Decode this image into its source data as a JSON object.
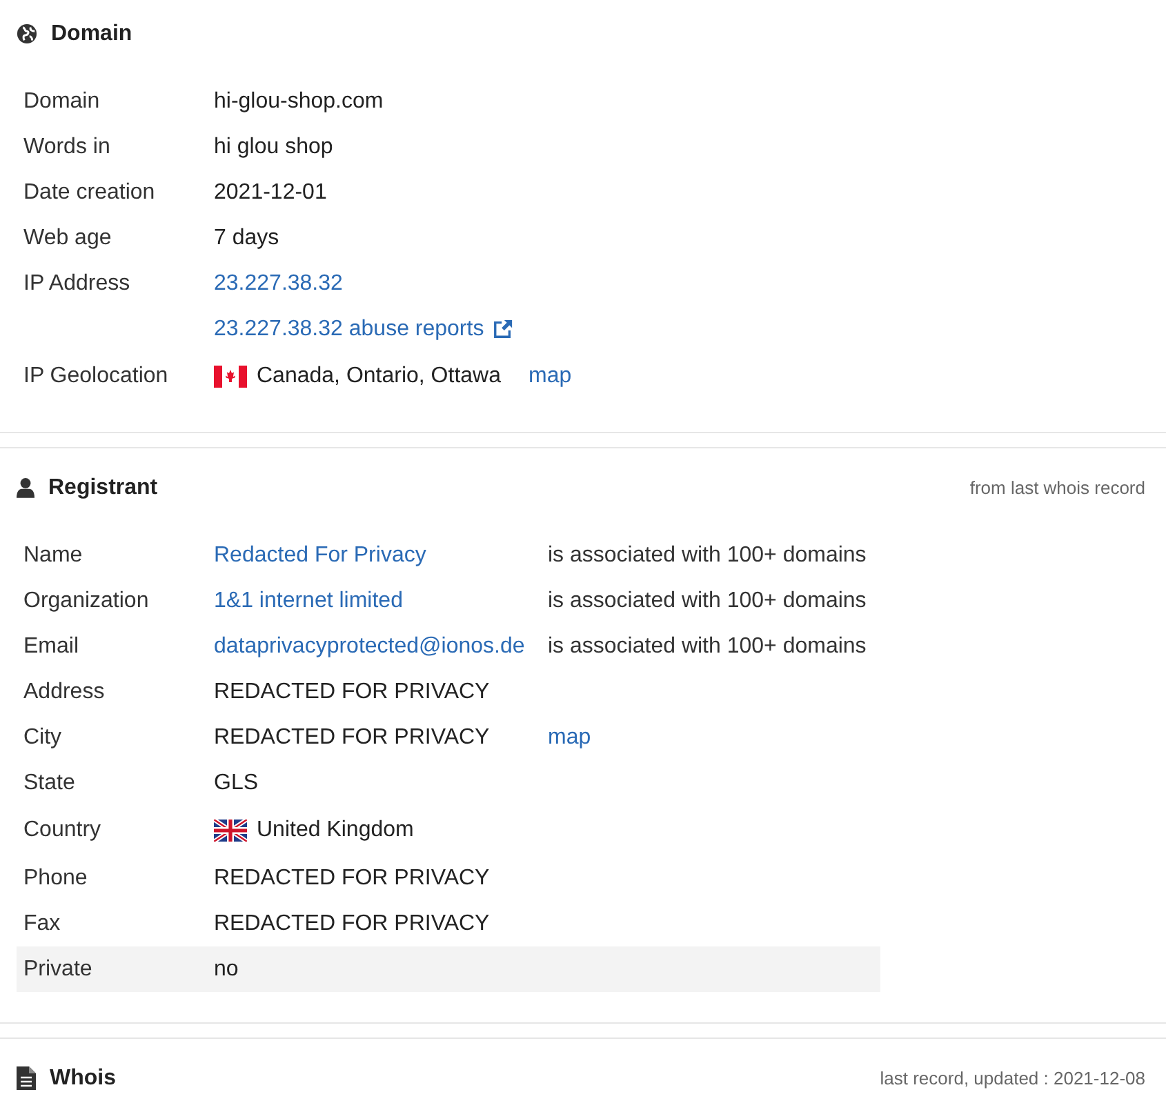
{
  "sections": [
    {
      "kind": "domain",
      "title": "Domain",
      "rows": [
        {
          "label": "Domain",
          "value": "hi-glou-shop.com",
          "kind": "text",
          "highlighted": false
        },
        {
          "label": "Words in",
          "value": "hi glou shop",
          "kind": "text",
          "highlighted": false
        },
        {
          "label": "Date creation",
          "value": "2021-12-01",
          "kind": "text",
          "highlighted": false
        },
        {
          "label": "Web age",
          "value": "7 days",
          "kind": "text",
          "highlighted": false
        },
        {
          "label": "IP Address",
          "value": "23.227.38.32",
          "kind": "link",
          "highlighted": false
        },
        {
          "value": "23.227.38.32 abuse reports",
          "kind": "external",
          "highlighted": false
        },
        {
          "label": "IP Geolocation",
          "value": "Canada, Ontario, Ottawa",
          "kind": "flagged",
          "map": "map",
          "highlighted": false
        }
      ]
    },
    {
      "kind": "registrant",
      "title": "Registrant",
      "note": "from last whois record",
      "rows": [
        {
          "label": "Name",
          "value": "Redacted For Privacy",
          "kind": "link",
          "assoc": "is associated with 100+ domains",
          "highlighted": false
        },
        {
          "label": "Organization",
          "value": "1&1 internet limited",
          "kind": "link",
          "assoc": "is associated with 100+ domains",
          "highlighted": false
        },
        {
          "label": "Email",
          "value": "dataprivacyprotected@ionos.de",
          "kind": "link",
          "assoc": "is associated with 100+ domains",
          "highlighted": false
        },
        {
          "label": "Address",
          "value": "REDACTED FOR PRIVACY",
          "kind": "text",
          "highlighted": false
        },
        {
          "label": "City",
          "value": "REDACTED FOR PRIVACY",
          "kind": "text",
          "map": "map",
          "highlighted": false
        },
        {
          "label": "State",
          "value": "GLS",
          "kind": "text",
          "highlighted": false
        },
        {
          "label": "Country",
          "value": "United Kingdom",
          "kind": "flagged",
          "highlighted": false
        },
        {
          "label": "Phone",
          "value": "REDACTED FOR PRIVACY",
          "kind": "text",
          "highlighted": false
        },
        {
          "label": "Fax",
          "value": "REDACTED FOR PRIVACY",
          "kind": "text",
          "highlighted": false
        },
        {
          "label": "Private",
          "value": "no",
          "kind": "text",
          "highlighted": true
        }
      ]
    },
    {
      "kind": "whois",
      "title": "Whois",
      "note": "last record, updated : 2021-12-08"
    }
  ]
}
